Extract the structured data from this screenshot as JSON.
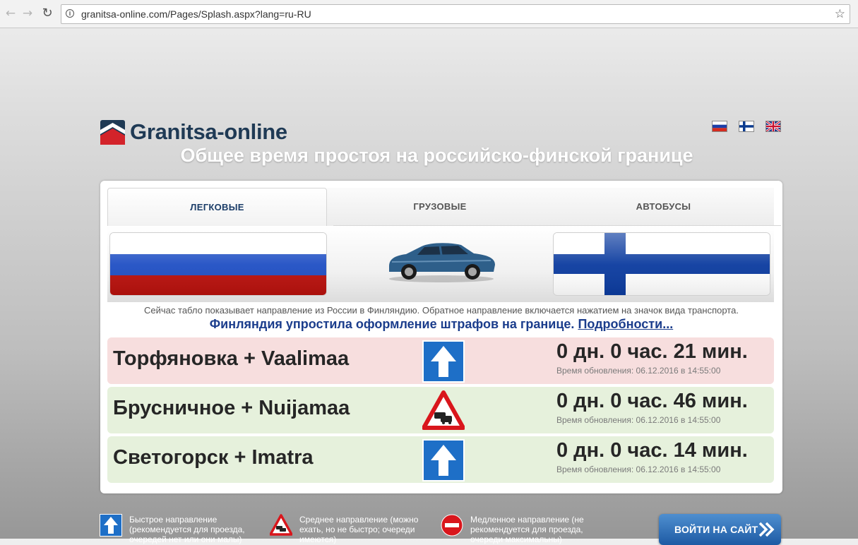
{
  "browser": {
    "url": "granitsa-online.com/Pages/Splash.aspx?lang=ru-RU"
  },
  "header": {
    "logo_text": "Granitsa-online",
    "title": "Общее время простоя на российско-финской границе",
    "languages": [
      "ru",
      "fi",
      "en"
    ]
  },
  "tabs": [
    {
      "label": "ЛЕГКОВЫЕ",
      "active": true
    },
    {
      "label": "ГРУЗОВЫЕ",
      "active": false
    },
    {
      "label": "АВТОБУСЫ",
      "active": false
    }
  ],
  "direction": {
    "from_flag": "russia-flag",
    "to_flag": "finland-flag",
    "vehicle": "car-icon"
  },
  "note": "Сейчас табло показывает направление из России в Финляндию. Обратное направление включается нажатием на значок вида транспорта.",
  "news": {
    "text": "Финляндия упростила оформление штрафов на границе.",
    "link": "Подробности..."
  },
  "crossings": [
    {
      "name": "Торфяновка + Vaalimaa",
      "status": "fast",
      "wait": "0 дн. 0 час. 21 мин.",
      "updated": "Время обновления: 06.12.2016 в 14:55:00"
    },
    {
      "name": "Брусничное + Nuijamaa",
      "status": "medium",
      "wait": "0 дн. 0 час. 46 мин.",
      "updated": "Время обновления: 06.12.2016 в 14:55:00"
    },
    {
      "name": "Светогорск + Imatra",
      "status": "fast",
      "wait": "0 дн. 0 час. 14 мин.",
      "updated": "Время обновления: 06.12.2016 в 14:55:00"
    }
  ],
  "legend": [
    {
      "icon": "up-arrow-icon",
      "text": "Быстрое направление (рекомендуется для проезда, очередей нет или они малы)"
    },
    {
      "icon": "traffic-jam-icon",
      "text": "Среднее направление (можно ехать, но не быстро; очереди имеются)"
    },
    {
      "icon": "no-entry-icon",
      "text": "Медленное направление (не рекомендуется для проезда, очереди максимальны)"
    }
  ],
  "enter_button": {
    "label": "ВОЙТИ НА САЙТ"
  },
  "colors": {
    "fast_row": "#f7dede",
    "medium_row": "#e6f1dc",
    "news_link": "#1b3d8c",
    "button": "#1d5aa4"
  }
}
